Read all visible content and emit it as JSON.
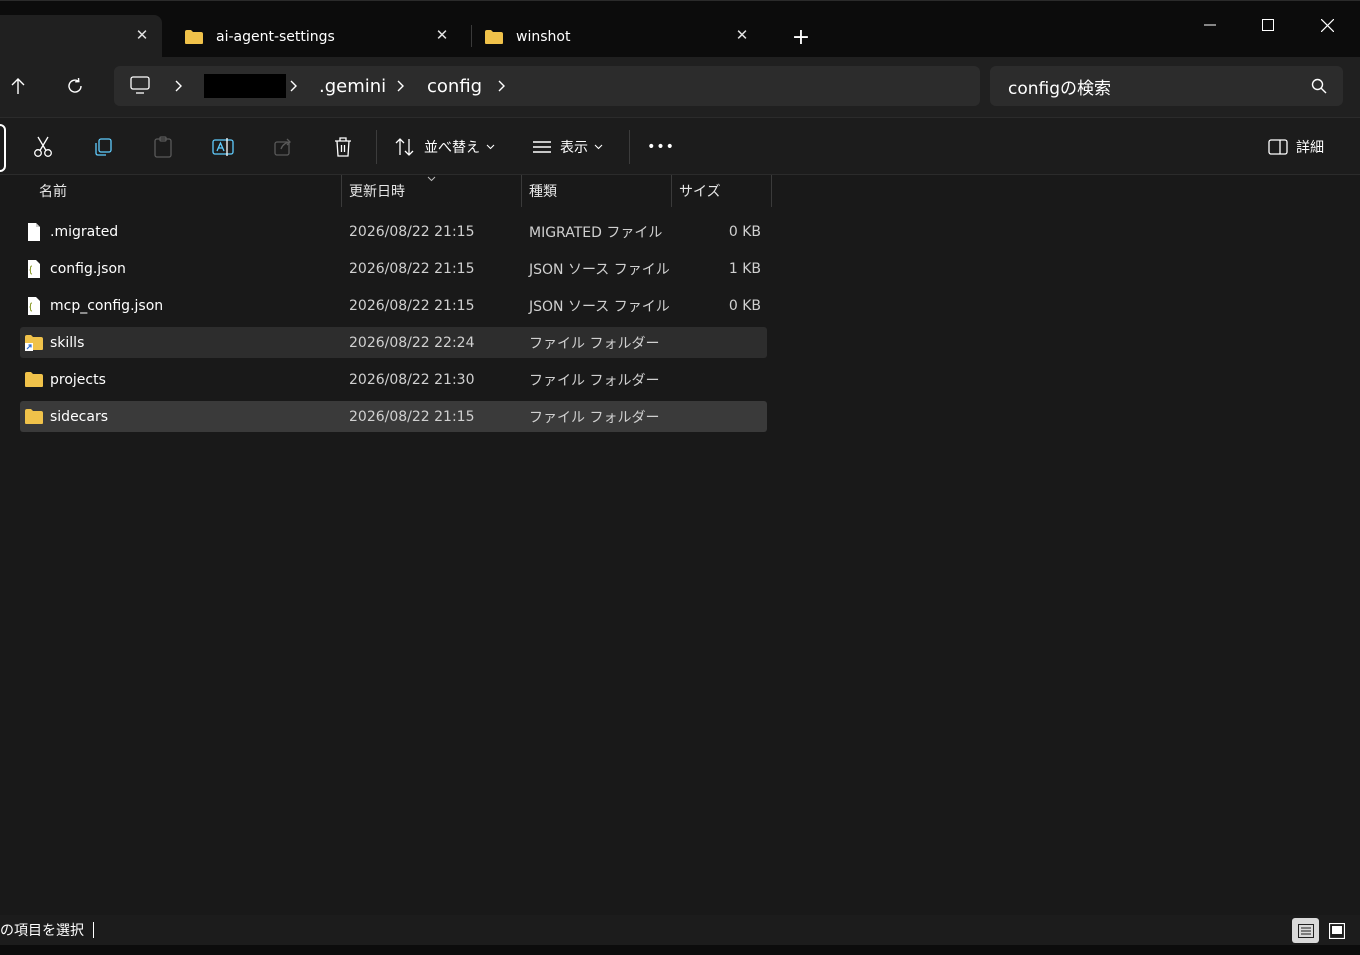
{
  "tabs": [
    {
      "label": "",
      "close": "✕"
    },
    {
      "label": "ai-agent-settings",
      "close": "✕"
    },
    {
      "label": "winshot",
      "close": "✕"
    }
  ],
  "new_tab": "+",
  "window_controls": {
    "minimize": "minimize-icon",
    "maximize": "maximize-icon",
    "close": "close-icon"
  },
  "breadcrumb": {
    "items": [
      "",
      ".gemini",
      "config"
    ],
    "redacted_color": "#000000"
  },
  "search": {
    "placeholder": "configの検索"
  },
  "commands": {
    "sort_label": "並べ替え",
    "view_label": "表示",
    "more": "•••",
    "details_label": "詳細"
  },
  "columns": {
    "name": "名前",
    "date": "更新日時",
    "type": "種類",
    "size": "サイズ"
  },
  "files": [
    {
      "name": ".migrated",
      "date": "2026/08/22 21:15",
      "type": "MIGRATED ファイル",
      "size": "0 KB",
      "icon": "file-icon",
      "state": "normal"
    },
    {
      "name": "config.json",
      "date": "2026/08/22 21:15",
      "type": "JSON ソース ファイル",
      "size": "1 KB",
      "icon": "json-file-icon",
      "state": "normal"
    },
    {
      "name": "mcp_config.json",
      "date": "2026/08/22 21:15",
      "type": "JSON ソース ファイル",
      "size": "0 KB",
      "icon": "json-file-icon",
      "state": "normal"
    },
    {
      "name": "skills",
      "date": "2026/08/22 22:24",
      "type": "ファイル フォルダー",
      "size": "",
      "icon": "folder-shortcut-icon",
      "state": "hover"
    },
    {
      "name": "projects",
      "date": "2026/08/22 21:30",
      "type": "ファイル フォルダー",
      "size": "",
      "icon": "folder-icon",
      "state": "normal"
    },
    {
      "name": "sidecars",
      "date": "2026/08/22 21:15",
      "type": "ファイル フォルダー",
      "size": "",
      "icon": "folder-icon",
      "state": "selected"
    }
  ],
  "status": {
    "text": "の項目を選択"
  },
  "colors": {
    "folder": "#f0c24a",
    "accent": "#60cdff",
    "selected_row": "#3a3a3a"
  }
}
